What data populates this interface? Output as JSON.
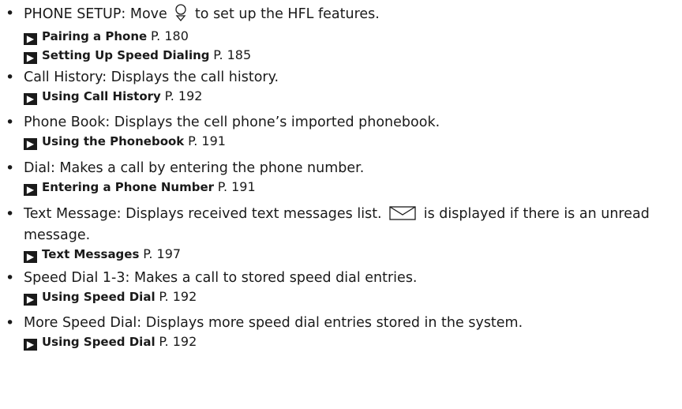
{
  "items": [
    {
      "term": "PHONE SETUP",
      "text_before_icon": ": Move ",
      "icon": "interface-dial-knob-icon",
      "text_after_icon": " to set up the HFL features.",
      "refs": [
        {
          "title": "Pairing a Phone",
          "page": "P. 180"
        },
        {
          "title": "Setting Up Speed Dialing",
          "page": "P. 185"
        }
      ]
    },
    {
      "term": "Call History",
      "text": ": Displays the call history.",
      "refs": [
        {
          "title": "Using Call History",
          "page": "P. 192"
        }
      ]
    },
    {
      "term": "Phone Book",
      "text": ": Displays the cell phone’s imported phonebook.",
      "refs": [
        {
          "title": "Using the Phonebook",
          "page": "P. 191"
        }
      ]
    },
    {
      "term": "Dial",
      "text": ": Makes a call by entering the phone number.",
      "refs": [
        {
          "title": "Entering a Phone Number",
          "page": "P. 191"
        }
      ]
    },
    {
      "term": "Text Message",
      "text_before_icon": ": Displays received text messages list. ",
      "icon": "envelope-icon",
      "text_after_icon": " is displayed if there is an unread message.",
      "refs": [
        {
          "title": "Text Messages",
          "page": "P. 197"
        }
      ]
    },
    {
      "term": "Speed Dial 1-3",
      "text": ": Makes a call to stored speed dial entries.",
      "refs": [
        {
          "title": "Using Speed Dial",
          "page": "P. 192"
        }
      ]
    },
    {
      "term": "More Speed Dial",
      "text": ": Displays more speed dial entries stored in the system.",
      "refs": [
        {
          "title": "Using Speed Dial",
          "page": "P. 192"
        }
      ]
    }
  ],
  "bullet_glyph": "•",
  "ref_glyph": "▶"
}
